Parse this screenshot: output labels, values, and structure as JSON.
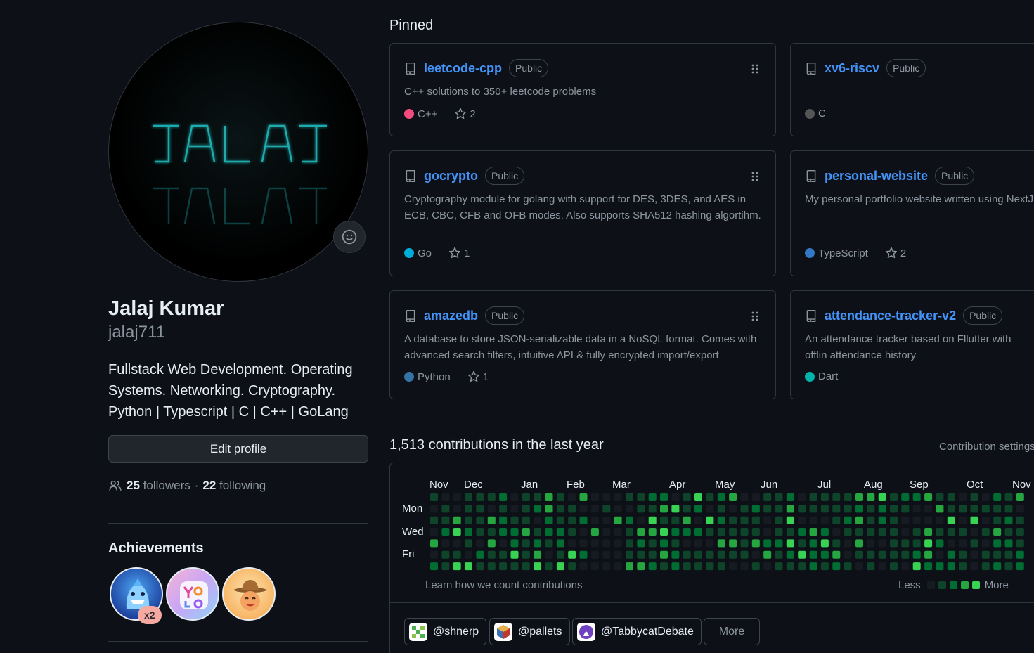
{
  "profile": {
    "fullname": "Jalaj Kumar",
    "username": "jalaj711",
    "bio": "Fullstack Web Development. Operating Systems. Networking. Cryptography. Python | Typescript | C | C++ | GoLang",
    "edit_label": "Edit profile",
    "followers_count": "25",
    "followers_label": "followers",
    "following_count": "22",
    "following_label": "following",
    "separator": "·"
  },
  "achievements": {
    "title": "Achievements",
    "badges": [
      "pull-shark",
      "yolo",
      "quickdraw"
    ],
    "multiplier": "x2"
  },
  "pinned": {
    "title": "Pinned",
    "repos": [
      {
        "name": "leetcode-cpp",
        "visibility": "Public",
        "description": "C++ solutions to 350+ leetcode problems",
        "language": "C++",
        "color": "#f34b7d",
        "stars": "2"
      },
      {
        "name": "xv6-riscv",
        "visibility": "Public",
        "description": "",
        "language": "C",
        "color": "#555555",
        "stars": ""
      },
      {
        "name": "gocrypto",
        "visibility": "Public",
        "description": "Cryptography module for golang with support for DES, 3DES, and AES in ECB, CBC, CFB and OFB modes. Also supports SHA512 hashing algortihm.",
        "language": "Go",
        "color": "#00ADD8",
        "stars": "1"
      },
      {
        "name": "personal-website",
        "visibility": "Public",
        "description": "My personal portfolio website written using NextJ",
        "language": "TypeScript",
        "color": "#3178c6",
        "stars": "2"
      },
      {
        "name": "amazedb",
        "visibility": "Public",
        "description": "A database to store JSON-serializable data in a NoSQL format. Comes with advanced search filters, intuitive API & fully encrypted import/export",
        "language": "Python",
        "color": "#3572A5",
        "stars": "1"
      },
      {
        "name": "attendance-tracker-v2",
        "visibility": "Public",
        "description": "An attendance tracker based on Fllutter with offlin attendance history",
        "language": "Dart",
        "color": "#00B4AB",
        "stars": ""
      }
    ]
  },
  "contributions": {
    "title": "1,513 contributions in the last year",
    "settings_label": "Contribution settings",
    "months": [
      "Nov",
      "Dec",
      "Jan",
      "Feb",
      "Mar",
      "Apr",
      "May",
      "Jun",
      "Jul",
      "Aug",
      "Sep",
      "Oct",
      "Nov"
    ],
    "days": [
      "Mon",
      "Wed",
      "Fri"
    ],
    "learn_label": "Learn how we count contributions",
    "less_label": "Less",
    "more_label": "More",
    "level_colors": [
      "#161b22",
      "#0e4429",
      "#006d32",
      "#26a641",
      "#39d353"
    ]
  },
  "orgs": {
    "items": [
      "@shnerp",
      "@pallets",
      "@TabbycatDebate"
    ],
    "more_label": "More"
  }
}
